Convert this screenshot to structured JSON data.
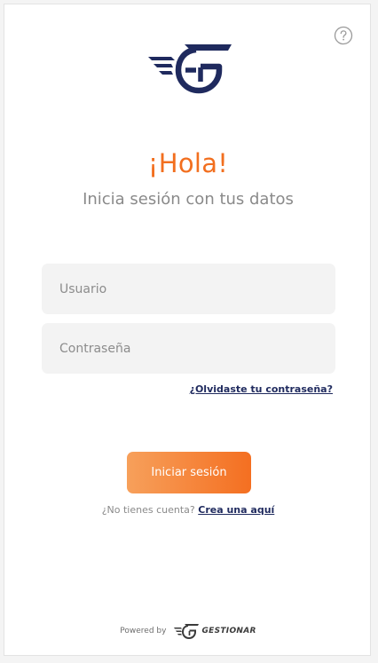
{
  "help": {
    "icon": "question-circle-icon"
  },
  "logo": {
    "icon": "gestionar-logo-icon",
    "color": "#1f2a5e"
  },
  "header": {
    "greeting": "¡Hola!",
    "subtitle": "Inicia sesión con tus datos"
  },
  "form": {
    "username_placeholder": "Usuario",
    "username_value": "",
    "password_placeholder": "Contraseña",
    "password_value": "",
    "forgot_link": "¿Olvidaste tu contraseña?",
    "submit_label": "Iniciar sesión"
  },
  "register": {
    "prompt": "¿No tienes cuenta?",
    "link": "Crea una aquí"
  },
  "footer": {
    "powered_by": "Powered by",
    "brand": "GESTIONAR"
  },
  "colors": {
    "accent": "#f26f1f",
    "brand_navy": "#1f2a5e",
    "button_gradient_start": "#f7a05b",
    "button_gradient_end": "#f46f21"
  }
}
